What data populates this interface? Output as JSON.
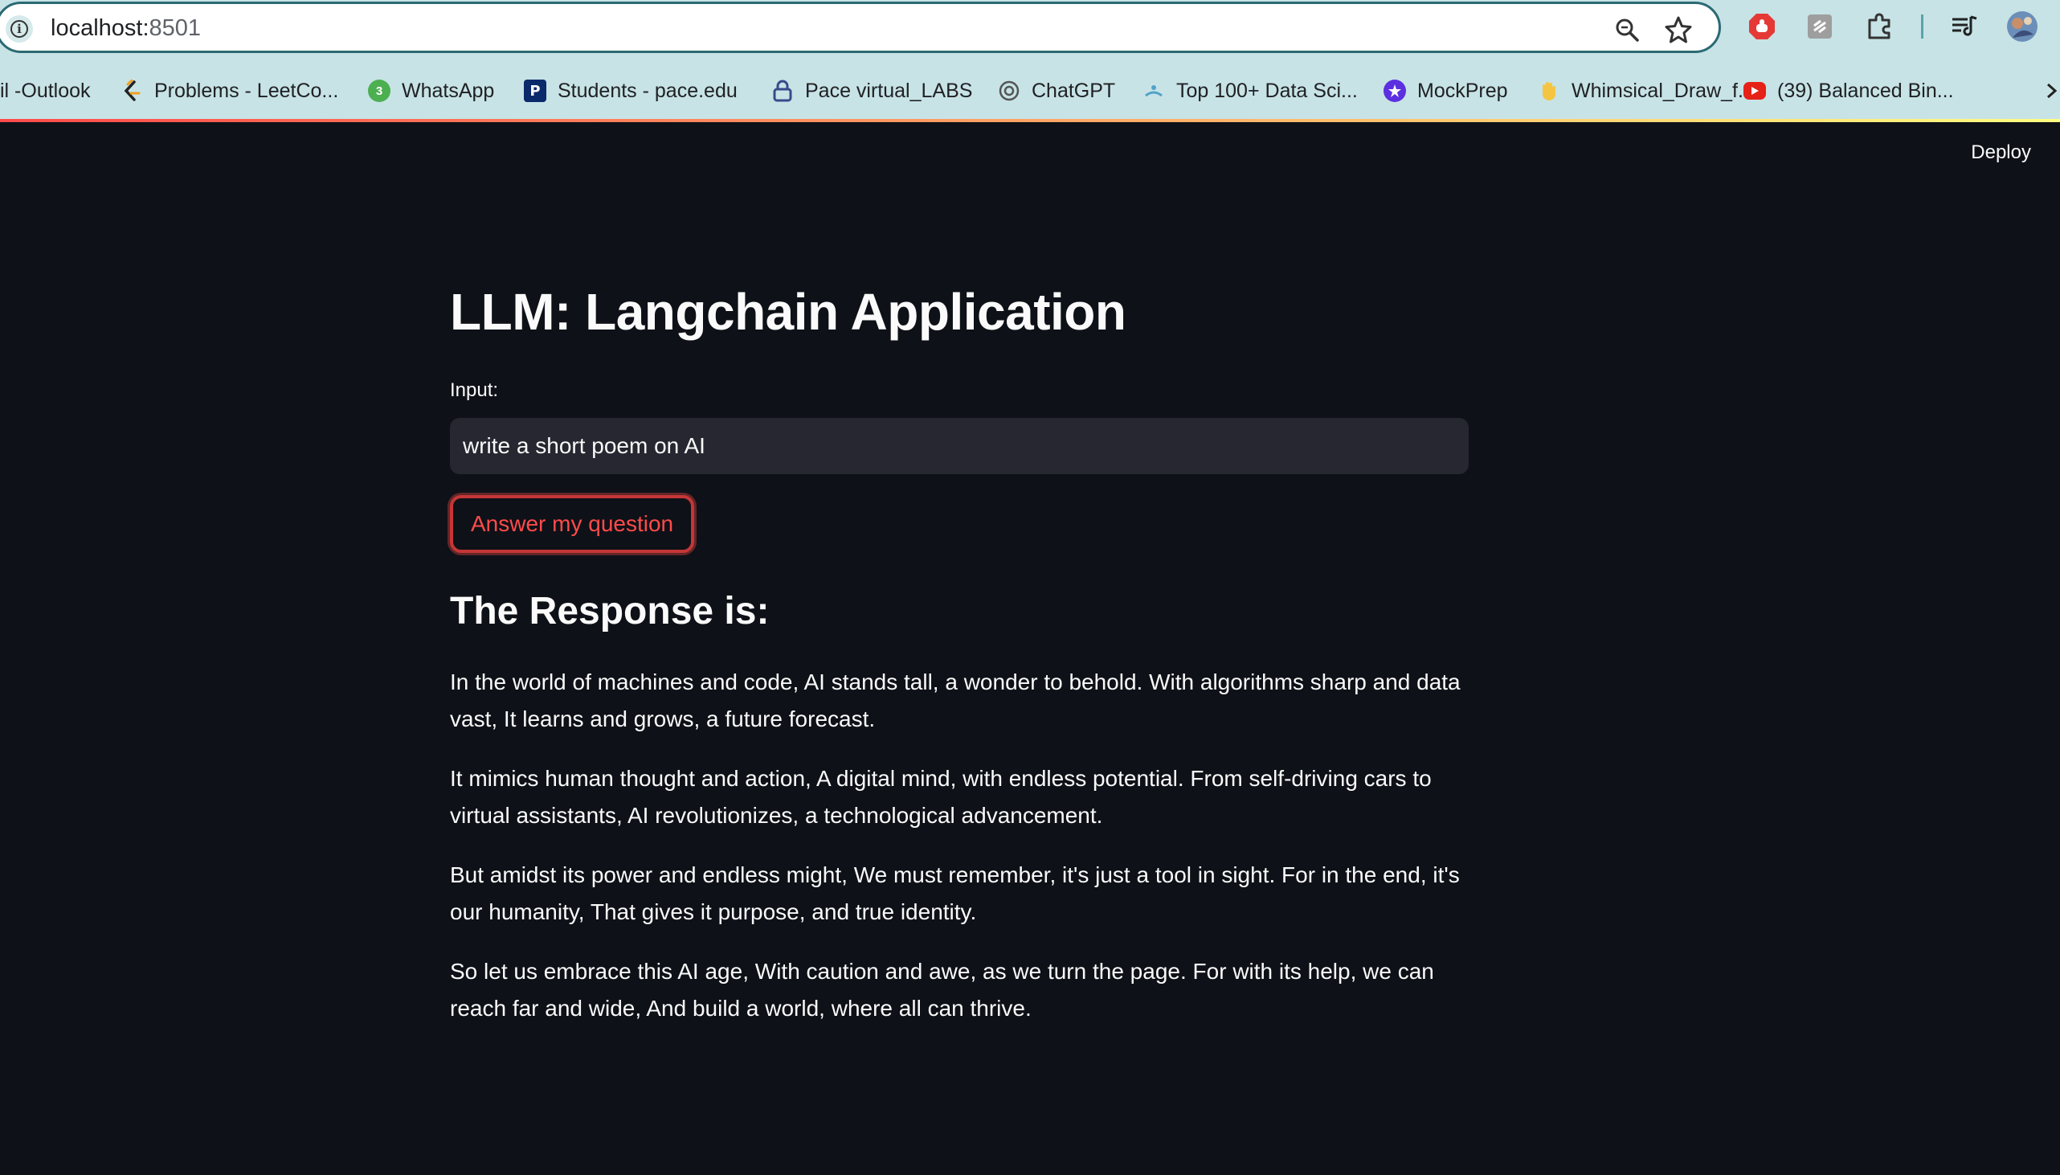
{
  "browser": {
    "url_host": "localhost:",
    "url_port": "8501",
    "bookmarks": [
      {
        "label": "il -Outlook",
        "icon": "outlook-icon"
      },
      {
        "label": "Problems - LeetCo...",
        "icon": "leetcode-icon"
      },
      {
        "label": "WhatsApp",
        "icon": "whatsapp-icon",
        "badge": "3"
      },
      {
        "label": "Students - pace.edu",
        "icon": "pace-icon",
        "glyph": "P"
      },
      {
        "label": "Pace virtual_LABS",
        "icon": "lock-icon"
      },
      {
        "label": "ChatGPT",
        "icon": "chatgpt-icon"
      },
      {
        "label": "Top 100+ Data Sci...",
        "icon": "datasci-icon"
      },
      {
        "label": "MockPrep",
        "icon": "mockprep-icon"
      },
      {
        "label": "Whimsical_Draw_f...",
        "icon": "wave-hand-icon"
      },
      {
        "label": "(39) Balanced Bin...",
        "icon": "youtube-icon"
      }
    ],
    "colors": {
      "chrome": "#c7e3e6",
      "accent": "#2b6a73"
    }
  },
  "app": {
    "deploy_label": "Deploy",
    "title": "LLM: Langchain Application",
    "input_label": "Input:",
    "input_value": "write a short poem on AI",
    "button_label": "Answer my question",
    "response_heading": "The Response is:",
    "paragraphs": [
      "In the world of machines and code, AI stands tall, a wonder to behold. With algorithms sharp and data vast, It learns and grows, a future forecast.",
      "It mimics human thought and action, A digital mind, with endless potential. From self-driving cars to virtual assistants, AI revolutionizes, a technological advancement.",
      "But amidst its power and endless might, We must remember, it's just a tool in sight. For in the end, it's our humanity, That gives it purpose, and true identity.",
      "So let us embrace this AI age, With caution and awe, as we turn the page. For with its help, we can reach far and wide, And build a world, where all can thrive."
    ],
    "colors": {
      "background": "#0e1117",
      "primary": "#ff4b4b",
      "input_bg": "#262730",
      "text": "#fafafa"
    }
  }
}
